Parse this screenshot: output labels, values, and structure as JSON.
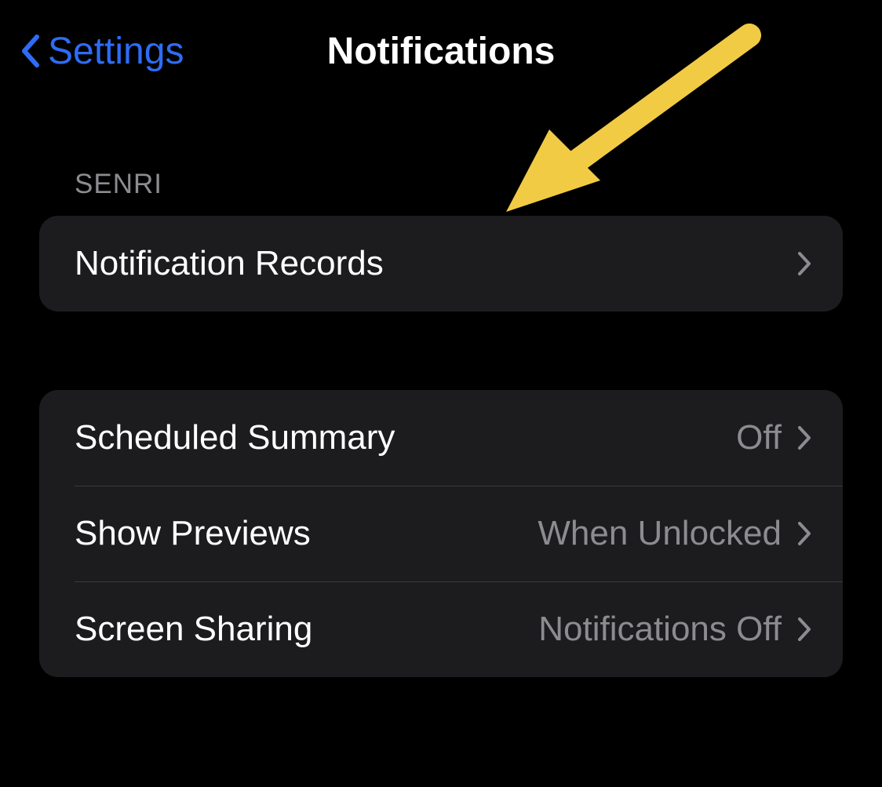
{
  "nav": {
    "back_label": "Settings",
    "title": "Notifications"
  },
  "sections": {
    "senri": {
      "header": "SENRI",
      "items": [
        {
          "label": "Notification Records"
        }
      ]
    },
    "general": {
      "items": [
        {
          "label": "Scheduled Summary",
          "value": "Off"
        },
        {
          "label": "Show Previews",
          "value": "When Unlocked"
        },
        {
          "label": "Screen Sharing",
          "value": "Notifications Off"
        }
      ]
    }
  },
  "annotation": {
    "arrow_color": "#f2cb45"
  }
}
